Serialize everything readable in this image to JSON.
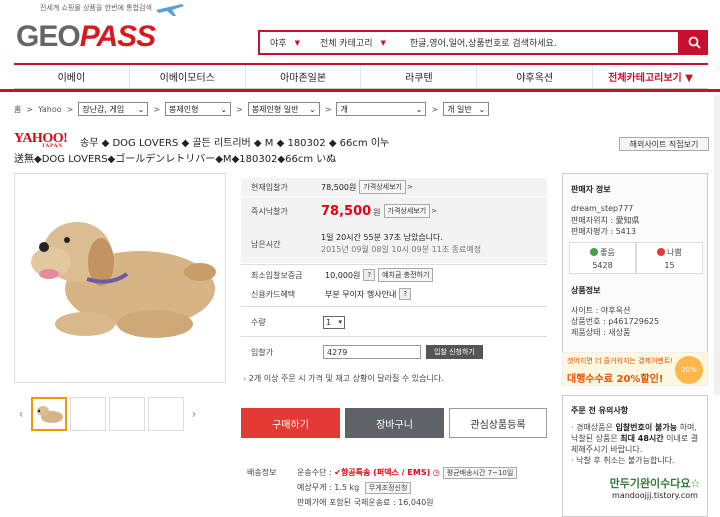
{
  "header": {
    "tagline": "전세계 쇼핑몰 상품을 한번에 통합검색",
    "logo_geo": "GEO",
    "logo_pass": "PASS",
    "search": {
      "site_select": "야후",
      "category_select": "전체 카테고리",
      "placeholder": "한글,영어,일어,상품번호로 검색하세요."
    }
  },
  "nav": [
    "이베이",
    "이베이모터스",
    "아마존일본",
    "라쿠텐",
    "야후옥션",
    "전체카테고리보기 ▼"
  ],
  "breadcrumb": {
    "home": "홈",
    "site": "Yahoo",
    "levels": [
      "장난감, 게임",
      "봉제인형",
      "봉제인형 일반",
      "개",
      "개 일반"
    ]
  },
  "product": {
    "brand_logo": "YAHOO!",
    "brand_sub": "JAPAN",
    "title_ko": "송무 ◆ DOG LOVERS ◆ 골든 리트리버 ◆ M ◆ 180302 ◆ 66cm 이누",
    "title_jp": "送無◆DOG LOVERS◆ゴールデンレトリバー◆M◆180302◆66cm いぬ",
    "original_site_button": "해외사이트 직접보기"
  },
  "info": {
    "current_price_label": "현재입찰가",
    "current_price": "78,500원",
    "price_detail_btn": "가격상세보기",
    "buynow_label": "즉시낙찰가",
    "buynow_price": "78,500",
    "buynow_unit": "원",
    "remaining_label": "남은시간",
    "remaining": "1일 20시간 55분 37초 남았습니다.",
    "end_time": "2015년 09월 08일 10시 09분 11초 종료예정",
    "min_bid_label": "최소입찰보증금",
    "min_bid": "10,000원",
    "charge_btn": "예치금 충전하기",
    "card_label": "신용카드혜택",
    "card_value": "부분 무이자 행사안내",
    "qty_label": "수량",
    "qty_value": "1",
    "bid_label": "입찰가",
    "bid_value": "4279",
    "bid_btn": "입찰 신청하기",
    "note": "2개 이상 주문 시 가격 및 재고 상황이 달라질 수 있습니다.",
    "buy_btn": "구매하기",
    "cart_btn": "장바구니",
    "wish_btn": "관심상품등록",
    "ship_label": "배송정보",
    "ship_method_label": "운송수단 :",
    "ship_method": "항공특송 (퍼덱스 / EMS)",
    "ship_eta": "평균배송시간 7~10일",
    "ship_weight": "예상무게 : 1.5 kg",
    "ship_free_btn": "무게조정신청",
    "ship_fee": "판매가에 포함된 국제운송료 : 16,040원"
  },
  "seller": {
    "title": "판매자 정보",
    "id": "dream_step777",
    "location": "판매자위치 : 愛知県",
    "rating": "판매자평가 : 5413",
    "pos_label": "좋음",
    "pos_value": "5428",
    "neg_label": "나쁨",
    "neg_value": "15",
    "product_info_title": "상품정보",
    "site": "사이트 : 야후옥션",
    "product_no": "상품번호 : p461729625",
    "condition": "제품상태 : 새상품"
  },
  "banner": {
    "line1": "겟어지면 더 즐거워지는 결제이벤트!",
    "line2": "대행수수료 20%할인!",
    "badge": "20%"
  },
  "notice": {
    "title": "주문 전 유의사항",
    "body1": "· 경매상품은 ",
    "body1b": "입찰번호이 불가능",
    "body2": "하며, 낙찰된 상품은 ",
    "body2b": "최대 48시간",
    "body3": "이내로 결제해주시기 바랍니다.",
    "body4": "· 낙찰 후 취소는 불가능합니다."
  },
  "watermark": {
    "line1": "만두기완이수다요☆",
    "line2": "mandoojjj.tistory.com"
  },
  "colors": {
    "accent": "#c8102e",
    "buy": "#e53935",
    "cart": "#5f6368"
  }
}
